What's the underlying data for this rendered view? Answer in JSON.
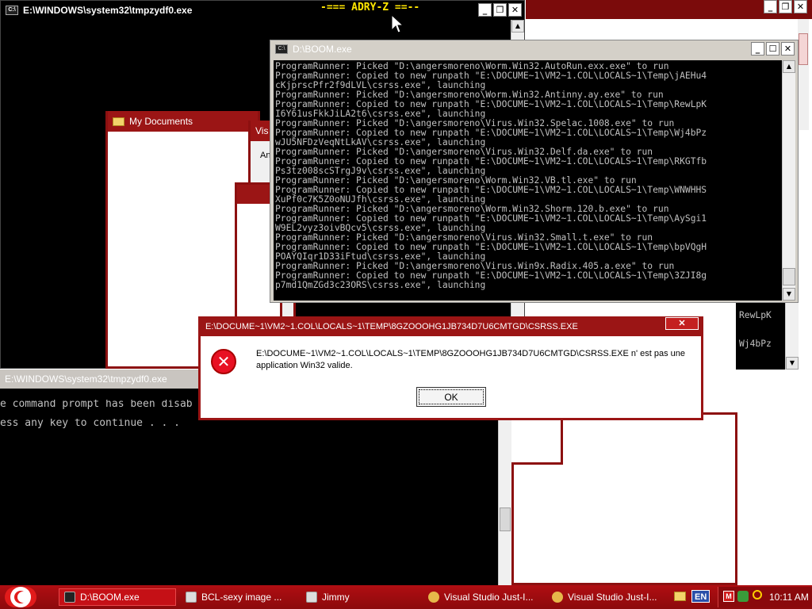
{
  "desktop_overlay_title": "-=== ADRY-Z ==--",
  "win_tmp_top": {
    "title": "E:\\WINDOWS\\system32\\tmpzydf0.exe"
  },
  "win_mydocs": {
    "title": "My Documents"
  },
  "win_vis": {
    "title": "Vis",
    "body_text": "An"
  },
  "win_boom": {
    "title": "D:\\BOOM.exe",
    "lines": [
      "ProgramRunner: Picked \"D:\\angersmoreno\\Worm.Win32.AutoRun.exx.exe\" to run",
      "ProgramRunner: Copied to new runpath \"E:\\DOCUME~1\\VM2~1.COL\\LOCALS~1\\Temp\\jAEHu4",
      "cKjprscPfr2f9dLVL\\csrss.exe\", launching",
      "ProgramRunner: Picked \"D:\\angersmoreno\\Worm.Win32.Antinny.ay.exe\" to run",
      "ProgramRunner: Copied to new runpath \"E:\\DOCUME~1\\VM2~1.COL\\LOCALS~1\\Temp\\RewLpK",
      "I6Y61usFkkJiLA2t6\\csrss.exe\", launching",
      "ProgramRunner: Picked \"D:\\angersmoreno\\Virus.Win32.Spelac.1008.exe\" to run",
      "ProgramRunner: Copied to new runpath \"E:\\DOCUME~1\\VM2~1.COL\\LOCALS~1\\Temp\\Wj4bPz",
      "wJU5NFDzVeqNtLkAV\\csrss.exe\", launching",
      "ProgramRunner: Picked \"D:\\angersmoreno\\Virus.Win32.Delf.da.exe\" to run",
      "ProgramRunner: Copied to new runpath \"E:\\DOCUME~1\\VM2~1.COL\\LOCALS~1\\Temp\\RKGTfb",
      "Ps3tz008scSTrgJ9v\\csrss.exe\", launching",
      "ProgramRunner: Picked \"D:\\angersmoreno\\Worm.Win32.VB.tl.exe\" to run",
      "ProgramRunner: Copied to new runpath \"E:\\DOCUME~1\\VM2~1.COL\\LOCALS~1\\Temp\\WNWHHS",
      "XuPf0c7K5Z0oNUJfh\\csrss.exe\", launching",
      "ProgramRunner: Picked \"D:\\angersmoreno\\Worm.Win32.Shorm.120.b.exe\" to run",
      "ProgramRunner: Copied to new runpath \"E:\\DOCUME~1\\VM2~1.COL\\LOCALS~1\\Temp\\AySgi1",
      "W9EL2vyz3oivBQcv5\\csrss.exe\", launching",
      "ProgramRunner: Picked \"D:\\angersmoreno\\Virus.Win32.Small.t.exe\" to run",
      "ProgramRunner: Copied to new runpath \"E:\\DOCUME~1\\VM2~1.COL\\LOCALS~1\\Temp\\bpVQgH",
      "POAYQIqr1D33iFtud\\csrss.exe\", launching",
      "ProgramRunner: Picked \"D:\\angersmoreno\\Virus.Win9x.Radix.405.a.exe\" to run",
      "ProgramRunner: Copied to new runpath \"E:\\DOCUME~1\\VM2~1.COL\\LOCALS~1\\Temp\\3ZJI8g",
      "p7md1QmZGd3c23ORS\\csrss.exe\", launching"
    ]
  },
  "win_right_console": {
    "lines": [
      "RewLpK",
      "Wj4bPz"
    ]
  },
  "win_tmp_bottom": {
    "title": "E:\\WINDOWS\\system32\\tmpzydf0.exe",
    "lines": [
      "e command prompt has been disab",
      "ess any key to continue . . ."
    ]
  },
  "error_dialog": {
    "title": "E:\\DOCUME~1\\VM2~1.COL\\LOCALS~1\\TEMP\\8GZOOOHG1JB734D7U6CMTGD\\CSRSS.EXE",
    "message_line1": "E:\\DOCUME~1\\VM2~1.COL\\LOCALS~1\\TEMP\\8GZOOOHG1JB734D7U6CMTGD\\CSRSS.EXE n' est pas une",
    "message_line2": "application Win32 valide.",
    "ok_label": "OK"
  },
  "taskbar": {
    "items": [
      {
        "label": "D:\\BOOM.exe"
      },
      {
        "label": "BCL-sexy image ..."
      },
      {
        "label": "Jimmy"
      },
      {
        "label": "Visual Studio Just-I..."
      },
      {
        "label": "Visual Studio Just-I..."
      }
    ],
    "lang": "EN",
    "clock": "10:11 AM"
  },
  "colors": {
    "titlebar_red": "#7b0b0b",
    "taskbar_red": "#b00e12",
    "error_red": "#e81123"
  }
}
